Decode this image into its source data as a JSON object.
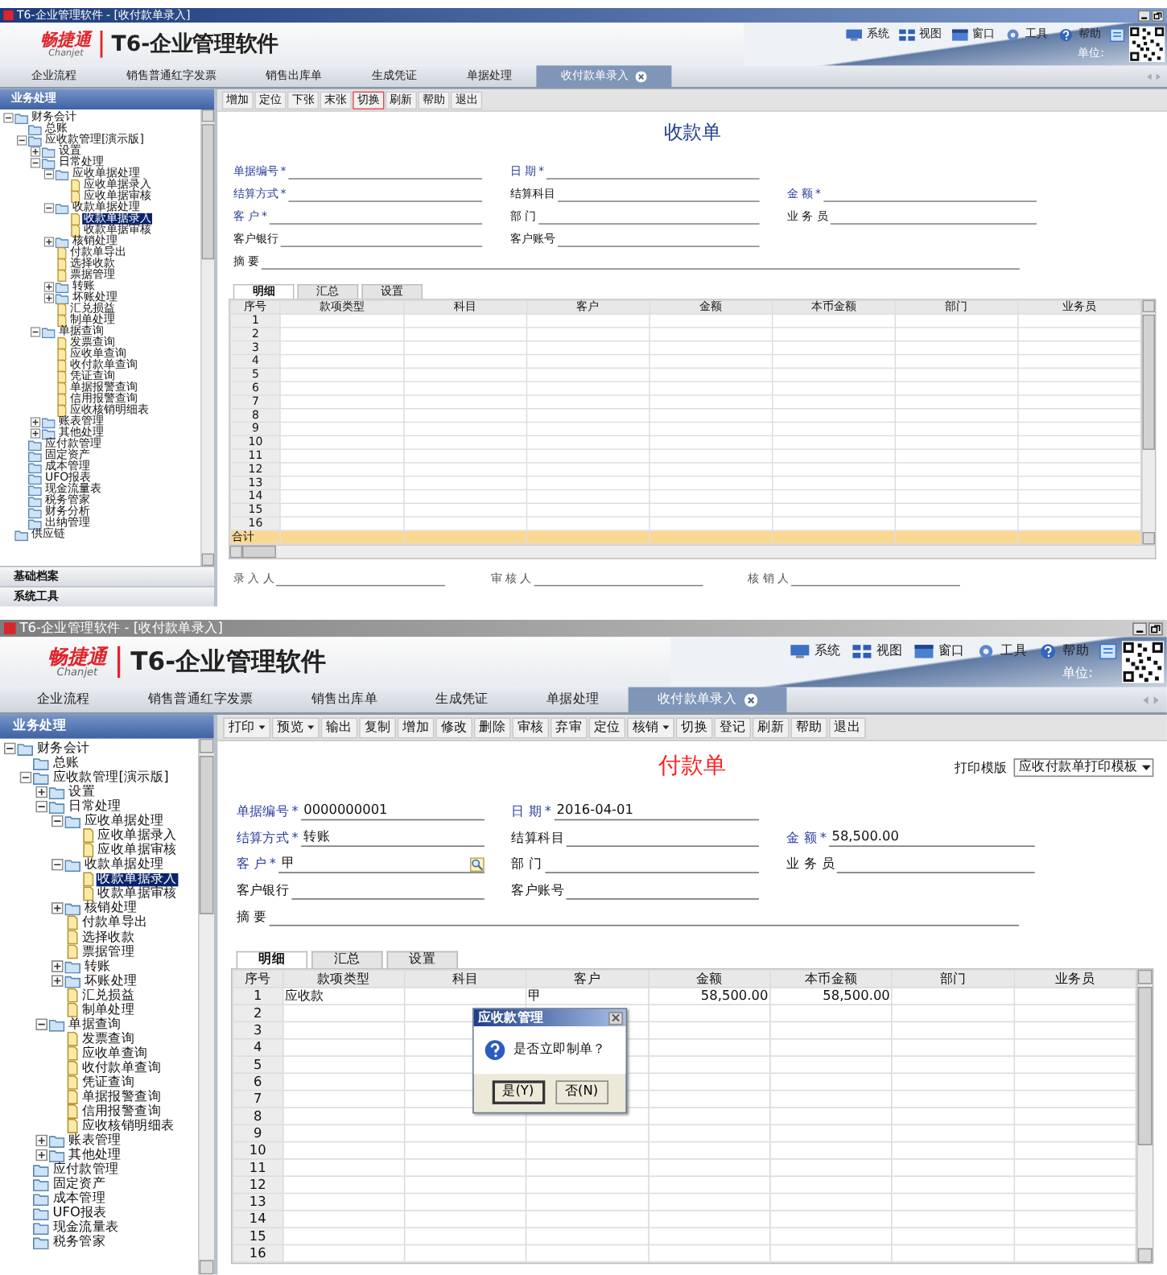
{
  "screens": [
    {
      "window": {
        "title": "T6-企业管理软件 - [收付款单录入]",
        "active": true
      },
      "brand": {
        "logo": "畅捷通",
        "logo_latin": "Chanjet",
        "product": "T6-企业管理软件"
      },
      "header_menu": [
        {
          "label": "系统"
        },
        {
          "label": "视图"
        },
        {
          "label": "窗口"
        },
        {
          "label": "工具"
        },
        {
          "label": "帮助"
        }
      ],
      "unit_label": "单位:",
      "tabs": [
        {
          "label": "企业流程",
          "selected": false
        },
        {
          "label": "销售普通红字发票",
          "selected": false
        },
        {
          "label": "销售出库单",
          "selected": false
        },
        {
          "label": "生成凭证",
          "selected": false
        },
        {
          "label": "单据处理",
          "selected": false
        },
        {
          "label": "收付款单录入",
          "selected": true,
          "closable": true
        }
      ],
      "sidebar": {
        "title": "业务处理",
        "tree": [
          {
            "label": "财务会计",
            "kind": "folder",
            "expanded": true,
            "selected": false,
            "children": [
              {
                "label": "总账",
                "kind": "folder",
                "selected": false
              },
              {
                "label": "应收款管理[演示版]",
                "kind": "folder",
                "expanded": true,
                "selected": false,
                "children": [
                  {
                    "label": "设置",
                    "kind": "folder",
                    "expanded": false,
                    "selected": false
                  },
                  {
                    "label": "日常处理",
                    "kind": "folder",
                    "expanded": true,
                    "selected": false,
                    "children": [
                      {
                        "label": "应收单据处理",
                        "kind": "folder",
                        "expanded": true,
                        "selected": false,
                        "children": [
                          {
                            "label": "应收单据录入",
                            "kind": "doc",
                            "selected": false
                          },
                          {
                            "label": "应收单据审核",
                            "kind": "doc",
                            "selected": false
                          }
                        ]
                      },
                      {
                        "label": "收款单据处理",
                        "kind": "folder",
                        "expanded": true,
                        "selected": false,
                        "children": [
                          {
                            "label": "收款单据录入",
                            "kind": "doc",
                            "selected": true
                          },
                          {
                            "label": "收款单据审核",
                            "kind": "doc",
                            "selected": false
                          }
                        ]
                      },
                      {
                        "label": "核销处理",
                        "kind": "folder",
                        "expanded": false,
                        "selected": false
                      },
                      {
                        "label": "付款单导出",
                        "kind": "doc",
                        "selected": false
                      },
                      {
                        "label": "选择收款",
                        "kind": "doc",
                        "selected": false
                      },
                      {
                        "label": "票据管理",
                        "kind": "doc",
                        "selected": false
                      },
                      {
                        "label": "转账",
                        "kind": "folder",
                        "expanded": false,
                        "selected": false
                      },
                      {
                        "label": "坏账处理",
                        "kind": "folder",
                        "expanded": false,
                        "selected": false
                      },
                      {
                        "label": "汇兑损益",
                        "kind": "doc",
                        "selected": false
                      },
                      {
                        "label": "制单处理",
                        "kind": "doc",
                        "selected": false
                      }
                    ]
                  },
                  {
                    "label": "单据查询",
                    "kind": "folder",
                    "expanded": true,
                    "selected": false,
                    "children": [
                      {
                        "label": "发票查询",
                        "kind": "doc",
                        "selected": false
                      },
                      {
                        "label": "应收单查询",
                        "kind": "doc",
                        "selected": false
                      },
                      {
                        "label": "收付款单查询",
                        "kind": "doc",
                        "selected": false
                      },
                      {
                        "label": "凭证查询",
                        "kind": "doc",
                        "selected": false
                      },
                      {
                        "label": "单据报警查询",
                        "kind": "doc",
                        "selected": false
                      },
                      {
                        "label": "信用报警查询",
                        "kind": "doc",
                        "selected": false
                      },
                      {
                        "label": "应收核销明细表",
                        "kind": "doc",
                        "selected": false
                      }
                    ]
                  },
                  {
                    "label": "账表管理",
                    "kind": "folder",
                    "expanded": false,
                    "selected": false
                  },
                  {
                    "label": "其他处理",
                    "kind": "folder",
                    "expanded": false,
                    "selected": false
                  }
                ]
              },
              {
                "label": "应付款管理",
                "kind": "folder",
                "selected": false
              },
              {
                "label": "固定资产",
                "kind": "folder",
                "selected": false
              },
              {
                "label": "成本管理",
                "kind": "folder",
                "selected": false
              },
              {
                "label": "UFO报表",
                "kind": "folder",
                "selected": false
              },
              {
                "label": "现金流量表",
                "kind": "folder",
                "selected": false
              },
              {
                "label": "税务管家",
                "kind": "folder",
                "selected": false
              },
              {
                "label": "财务分析",
                "kind": "folder",
                "selected": false
              },
              {
                "label": "出纳管理",
                "kind": "folder",
                "selected": false
              }
            ]
          },
          {
            "label": "供应链",
            "kind": "folder",
            "selected": false
          }
        ],
        "sections": [
          "基础档案",
          "系统工具"
        ]
      },
      "toolbar": [
        {
          "label": "增加",
          "dropdown": false,
          "highlighted": false
        },
        {
          "label": "定位",
          "dropdown": false,
          "highlighted": false
        },
        {
          "label": "下张",
          "dropdown": false,
          "highlighted": false
        },
        {
          "label": "末张",
          "dropdown": false,
          "highlighted": false
        },
        {
          "label": "切换",
          "dropdown": false,
          "highlighted": true
        },
        {
          "label": "刷新",
          "dropdown": false,
          "highlighted": false
        },
        {
          "label": "帮助",
          "dropdown": false,
          "highlighted": false
        },
        {
          "label": "退出",
          "dropdown": false,
          "highlighted": false
        }
      ],
      "form": {
        "title": "收款单",
        "color": "#23408e",
        "fields": [
          [
            {
              "label": "单据编号",
              "required": true,
              "mark": "*"
            },
            {
              "label": "日 期",
              "required": true,
              "mark": "*"
            }
          ],
          [
            {
              "label": "结算方式",
              "required": true,
              "mark": "*"
            },
            {
              "label": "结算科目",
              "required": false
            },
            {
              "label": "金 额",
              "required": true,
              "mark": "*"
            }
          ],
          [
            {
              "label": "客 户",
              "required": true,
              "mark": "*"
            },
            {
              "label": "部 门",
              "required": false
            },
            {
              "label": "业 务 员",
              "required": false
            }
          ],
          [
            {
              "label": "客户银行",
              "required": false
            },
            {
              "label": "客户账号",
              "required": false
            }
          ],
          [
            {
              "label": "摘 要",
              "required": false
            }
          ]
        ]
      },
      "grid": {
        "tabs": [
          {
            "label": "明细",
            "selected": true
          },
          {
            "label": "汇总",
            "selected": false
          },
          {
            "label": "设置",
            "selected": false
          }
        ],
        "columns": [
          "序号",
          "款项类型",
          "科目",
          "客户",
          "金额",
          "本币金额",
          "部门",
          "业务员"
        ],
        "rows": [
          {
            "number": "1"
          },
          {
            "number": "2"
          },
          {
            "number": "3"
          },
          {
            "number": "4"
          },
          {
            "number": "5"
          },
          {
            "number": "6"
          },
          {
            "number": "7"
          },
          {
            "number": "8"
          },
          {
            "number": "9"
          },
          {
            "number": "10"
          },
          {
            "number": "11"
          },
          {
            "number": "12"
          },
          {
            "number": "13"
          },
          {
            "number": "14"
          },
          {
            "number": "15"
          },
          {
            "number": "16"
          }
        ],
        "total_label": "合计"
      },
      "footer": [
        {
          "label": "录 入 人"
        },
        {
          "label": "审 核 人"
        },
        {
          "label": "核 销 人"
        }
      ]
    },
    {
      "window": {
        "title": "T6-企业管理软件 - [收付款单录入]",
        "active": false
      },
      "brand": {
        "logo": "畅捷通",
        "logo_latin": "Chanjet",
        "product": "T6-企业管理软件"
      },
      "header_menu": [
        {
          "label": "系统"
        },
        {
          "label": "视图"
        },
        {
          "label": "窗口"
        },
        {
          "label": "工具"
        },
        {
          "label": "帮助"
        }
      ],
      "unit_label": "单位:",
      "tabs": [
        {
          "label": "企业流程",
          "selected": false
        },
        {
          "label": "销售普通红字发票",
          "selected": false
        },
        {
          "label": "销售出库单",
          "selected": false
        },
        {
          "label": "生成凭证",
          "selected": false
        },
        {
          "label": "单据处理",
          "selected": false
        },
        {
          "label": "收付款单录入",
          "selected": true,
          "closable": true
        }
      ],
      "sidebar": {
        "title": "业务处理",
        "tree": [
          {
            "label": "财务会计",
            "kind": "folder",
            "expanded": true,
            "selected": false,
            "children": [
              {
                "label": "总账",
                "kind": "folder",
                "selected": false
              },
              {
                "label": "应收款管理[演示版]",
                "kind": "folder",
                "expanded": true,
                "selected": false,
                "children": [
                  {
                    "label": "设置",
                    "kind": "folder",
                    "expanded": false,
                    "selected": false
                  },
                  {
                    "label": "日常处理",
                    "kind": "folder",
                    "expanded": true,
                    "selected": false,
                    "children": [
                      {
                        "label": "应收单据处理",
                        "kind": "folder",
                        "expanded": true,
                        "selected": false,
                        "children": [
                          {
                            "label": "应收单据录入",
                            "kind": "doc",
                            "selected": false
                          },
                          {
                            "label": "应收单据审核",
                            "kind": "doc",
                            "selected": false
                          }
                        ]
                      },
                      {
                        "label": "收款单据处理",
                        "kind": "folder",
                        "expanded": true,
                        "selected": false,
                        "children": [
                          {
                            "label": "收款单据录入",
                            "kind": "doc",
                            "selected": true
                          },
                          {
                            "label": "收款单据审核",
                            "kind": "doc",
                            "selected": false
                          }
                        ]
                      },
                      {
                        "label": "核销处理",
                        "kind": "folder",
                        "expanded": false,
                        "selected": false
                      },
                      {
                        "label": "付款单导出",
                        "kind": "doc",
                        "selected": false
                      },
                      {
                        "label": "选择收款",
                        "kind": "doc",
                        "selected": false
                      },
                      {
                        "label": "票据管理",
                        "kind": "doc",
                        "selected": false
                      },
                      {
                        "label": "转账",
                        "kind": "folder",
                        "expanded": false,
                        "selected": false
                      },
                      {
                        "label": "坏账处理",
                        "kind": "folder",
                        "expanded": false,
                        "selected": false
                      },
                      {
                        "label": "汇兑损益",
                        "kind": "doc",
                        "selected": false
                      },
                      {
                        "label": "制单处理",
                        "kind": "doc",
                        "selected": false
                      }
                    ]
                  },
                  {
                    "label": "单据查询",
                    "kind": "folder",
                    "expanded": true,
                    "selected": false,
                    "children": [
                      {
                        "label": "发票查询",
                        "kind": "doc",
                        "selected": false
                      },
                      {
                        "label": "应收单查询",
                        "kind": "doc",
                        "selected": false
                      },
                      {
                        "label": "收付款单查询",
                        "kind": "doc",
                        "selected": false
                      },
                      {
                        "label": "凭证查询",
                        "kind": "doc",
                        "selected": false
                      },
                      {
                        "label": "单据报警查询",
                        "kind": "doc",
                        "selected": false
                      },
                      {
                        "label": "信用报警查询",
                        "kind": "doc",
                        "selected": false
                      },
                      {
                        "label": "应收核销明细表",
                        "kind": "doc",
                        "selected": false
                      }
                    ]
                  },
                  {
                    "label": "账表管理",
                    "kind": "folder",
                    "expanded": false,
                    "selected": false
                  },
                  {
                    "label": "其他处理",
                    "kind": "folder",
                    "expanded": false,
                    "selected": false
                  }
                ]
              },
              {
                "label": "应付款管理",
                "kind": "folder",
                "selected": false
              },
              {
                "label": "固定资产",
                "kind": "folder",
                "selected": false
              },
              {
                "label": "成本管理",
                "kind": "folder",
                "selected": false
              },
              {
                "label": "UFO报表",
                "kind": "folder",
                "selected": false
              },
              {
                "label": "现金流量表",
                "kind": "folder",
                "selected": false
              },
              {
                "label": "税务管家",
                "kind": "folder",
                "selected": false
              }
            ]
          }
        ]
      },
      "toolbar": [
        {
          "label": "打印",
          "dropdown": true,
          "highlighted": false
        },
        {
          "label": "预览",
          "dropdown": true,
          "highlighted": false
        },
        {
          "label": "输出",
          "dropdown": false,
          "highlighted": false
        },
        {
          "label": "复制",
          "dropdown": false,
          "highlighted": false
        },
        {
          "label": "增加",
          "dropdown": false,
          "highlighted": false
        },
        {
          "label": "修改",
          "dropdown": false,
          "highlighted": false
        },
        {
          "label": "删除",
          "dropdown": false,
          "highlighted": false
        },
        {
          "label": "审核",
          "dropdown": false,
          "highlighted": false
        },
        {
          "label": "弃审",
          "dropdown": false,
          "highlighted": false
        },
        {
          "label": "定位",
          "dropdown": false,
          "highlighted": false
        },
        {
          "label": "核销",
          "dropdown": true,
          "highlighted": false
        },
        {
          "label": "切换",
          "dropdown": false,
          "highlighted": false
        },
        {
          "label": "登记",
          "dropdown": false,
          "highlighted": false
        },
        {
          "label": "刷新",
          "dropdown": false,
          "highlighted": false
        },
        {
          "label": "帮助",
          "dropdown": false,
          "highlighted": false
        },
        {
          "label": "退出",
          "dropdown": false,
          "highlighted": false
        }
      ],
      "form": {
        "title": "付款单",
        "color": "#ff2020",
        "print_template": {
          "label": "打印模版",
          "value": "应收付款单打印模板"
        },
        "fields": [
          [
            {
              "label": "单据编号",
              "required": true,
              "mark": "*",
              "value": "0000000001"
            },
            {
              "label": "日 期",
              "required": true,
              "mark": "*",
              "value": "2016-04-01"
            }
          ],
          [
            {
              "label": "结算方式",
              "required": true,
              "mark": "*",
              "value": "转账"
            },
            {
              "label": "结算科目",
              "required": false
            },
            {
              "label": "金 额",
              "required": true,
              "mark": "*",
              "value": "58,500.00"
            }
          ],
          [
            {
              "label": "客 户",
              "required": true,
              "mark": "*",
              "value": "甲",
              "lookup": true
            },
            {
              "label": "部 门",
              "required": false
            },
            {
              "label": "业 务 员",
              "required": false
            }
          ],
          [
            {
              "label": "客户银行",
              "required": false
            },
            {
              "label": "客户账号",
              "required": false
            }
          ],
          [
            {
              "label": "摘 要",
              "required": false
            }
          ]
        ]
      },
      "grid": {
        "tabs": [
          {
            "label": "明细",
            "selected": true
          },
          {
            "label": "汇总",
            "selected": false
          },
          {
            "label": "设置",
            "selected": false
          }
        ],
        "columns": [
          "序号",
          "款项类型",
          "科目",
          "客户",
          "金额",
          "本币金额",
          "部门",
          "业务员"
        ],
        "rows": [
          {
            "number": "1",
            "type": "应收款",
            "customer": "甲",
            "amount": "58,500.00",
            "local_amount": "58,500.00"
          },
          {
            "number": "2"
          },
          {
            "number": "3"
          },
          {
            "number": "4"
          },
          {
            "number": "5"
          },
          {
            "number": "6"
          },
          {
            "number": "7"
          },
          {
            "number": "8"
          },
          {
            "number": "9"
          },
          {
            "number": "10"
          },
          {
            "number": "11"
          },
          {
            "number": "12"
          },
          {
            "number": "13"
          },
          {
            "number": "14"
          },
          {
            "number": "15"
          },
          {
            "number": "16"
          }
        ]
      },
      "dialog": {
        "title": "应收款管理",
        "message": "是否立即制单？",
        "buttons": [
          {
            "label": "是(Y)",
            "default": true
          },
          {
            "label": "否(N)",
            "default": false
          }
        ]
      }
    }
  ]
}
